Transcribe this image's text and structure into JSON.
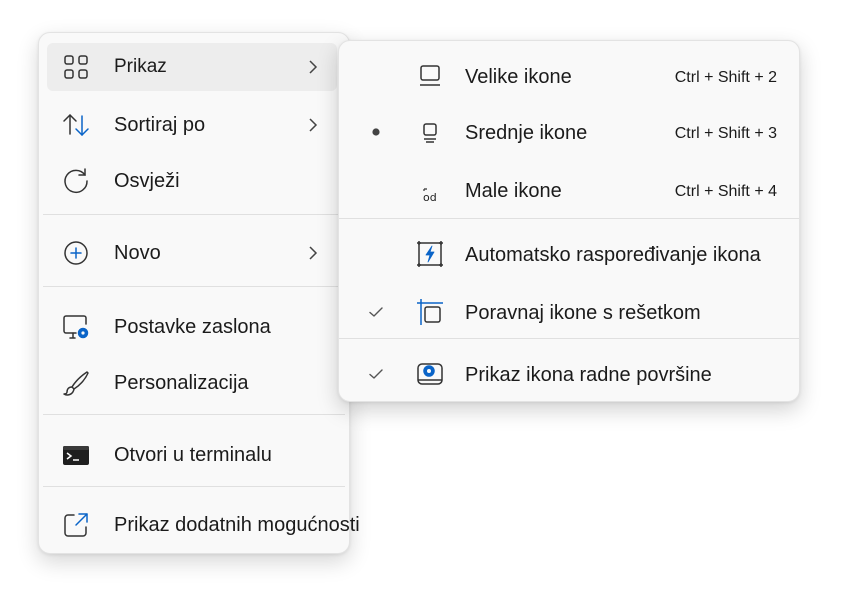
{
  "colors": {
    "menu_bg": "#f9f9f9",
    "hover_bg": "#ededed",
    "accent": "#0a64c8",
    "text": "#1b1b1b"
  },
  "main_menu": {
    "items": [
      {
        "label": "Prikaz",
        "icon": "grid-view-icon",
        "has_submenu": true
      },
      {
        "label": "Sortiraj po",
        "icon": "sort-arrows-icon",
        "has_submenu": true
      },
      {
        "label": "Osvježi",
        "icon": "refresh-icon",
        "has_submenu": false
      },
      {
        "label": "Novo",
        "icon": "add-circle-icon",
        "has_submenu": true
      },
      {
        "label": "Postavke zaslona",
        "icon": "display-settings-icon",
        "has_submenu": false
      },
      {
        "label": "Personalizacija",
        "icon": "paintbrush-icon",
        "has_submenu": false
      },
      {
        "label": "Otvori u terminalu",
        "icon": "terminal-icon",
        "has_submenu": false
      },
      {
        "label": "Prikaz dodatnih mogućnosti",
        "icon": "share-external-icon",
        "has_submenu": false
      }
    ]
  },
  "view_submenu": {
    "items": [
      {
        "label": "Velike ikone",
        "shortcut": "Ctrl + Shift + 2",
        "icon": "large-icons-icon",
        "mark": "none"
      },
      {
        "label": "Srednje ikone",
        "shortcut": "Ctrl + Shift + 3",
        "icon": "medium-icons-icon",
        "mark": "bullet"
      },
      {
        "label": "Male ikone",
        "shortcut": "Ctrl + Shift + 4",
        "icon": "small-icons-icon",
        "icon_text": "od",
        "mark": "none"
      },
      {
        "label": "Automatsko raspoređivanje ikona",
        "shortcut": "",
        "icon": "auto-arrange-icon",
        "mark": "none"
      },
      {
        "label": "Poravnaj ikone s rešetkom",
        "shortcut": "",
        "icon": "align-grid-icon",
        "mark": "check"
      },
      {
        "label": "Prikaz ikona radne površine",
        "shortcut": "",
        "icon": "show-desktop-icons-icon",
        "mark": "check"
      }
    ]
  }
}
